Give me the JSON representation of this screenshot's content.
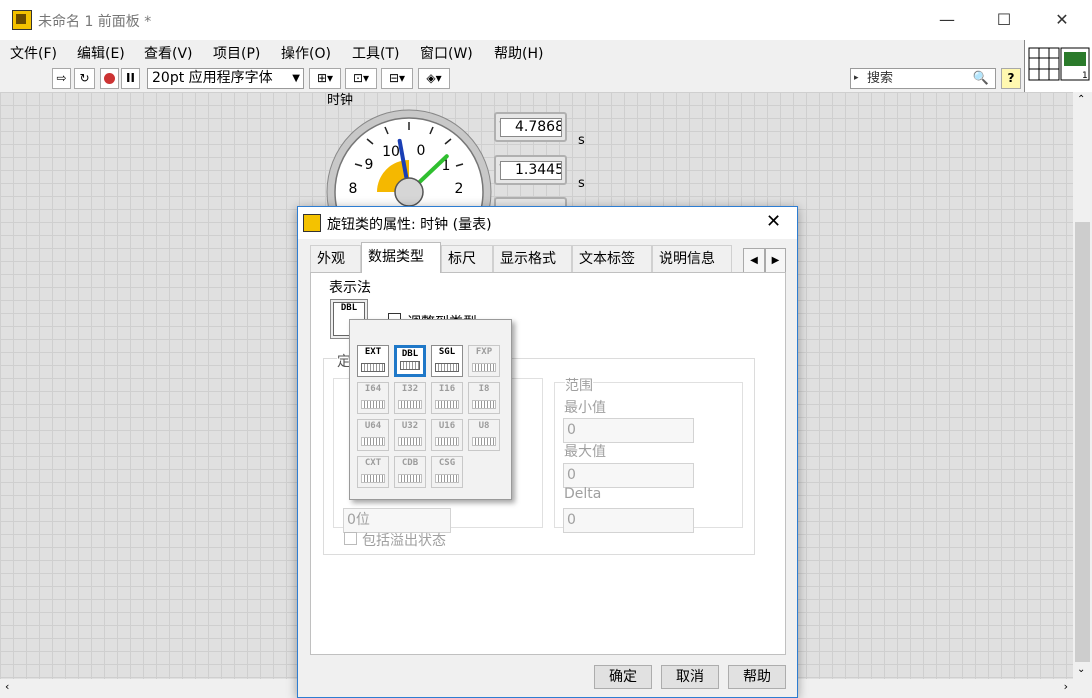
{
  "window": {
    "title": "未命名 1 前面板 *",
    "min": "—",
    "max": "☐",
    "close": "✕"
  },
  "menu": [
    "文件(F)",
    "编辑(E)",
    "查看(V)",
    "项目(P)",
    "操作(O)",
    "工具(T)",
    "窗口(W)",
    "帮助(H)"
  ],
  "toolbar": {
    "font": "20pt 应用程序字体",
    "search_placeholder": "搜索",
    "help": "?"
  },
  "front_panel": {
    "gauge": {
      "label": "时钟",
      "ticks": [
        "0",
        "1",
        "2",
        "8",
        "9",
        "10"
      ],
      "needle_a": 10.2,
      "needle_b": 1.35
    },
    "indicators": [
      {
        "value": "4.7868",
        "unit": "s"
      },
      {
        "value": "1.3445",
        "unit": "s"
      }
    ]
  },
  "dialog": {
    "title": "旋钮类的属性: 时钟 (量表)",
    "tabs": [
      "外观",
      "数据类型",
      "标尺",
      "显示格式",
      "文本标签",
      "说明信息"
    ],
    "active_tab": "数据类型",
    "representation_label": "表示法",
    "representation_current": "DBL",
    "partial_check": "调整到类型",
    "fixed_point_partial": "定",
    "range": {
      "title": "范围",
      "min_label": "最小值",
      "min_value": "0",
      "max_label": "最大值",
      "max_value": "0",
      "delta_label": "Delta",
      "delta_value": "0"
    },
    "word_length": "0位",
    "include_overflow": "包括溢出状态",
    "buttons": {
      "ok": "确定",
      "cancel": "取消",
      "help": "帮助"
    }
  },
  "representation_popup": {
    "selected": "DBL",
    "types": [
      {
        "label": "EXT",
        "enabled": true
      },
      {
        "label": "DBL",
        "enabled": true
      },
      {
        "label": "SGL",
        "enabled": true
      },
      {
        "label": "FXP",
        "enabled": false
      },
      {
        "label": "I64",
        "enabled": false
      },
      {
        "label": "I32",
        "enabled": false
      },
      {
        "label": "I16",
        "enabled": false
      },
      {
        "label": "I8",
        "enabled": false
      },
      {
        "label": "U64",
        "enabled": false
      },
      {
        "label": "U32",
        "enabled": false
      },
      {
        "label": "U16",
        "enabled": false
      },
      {
        "label": "U8",
        "enabled": false
      },
      {
        "label": "CXT",
        "enabled": false
      },
      {
        "label": "CDB",
        "enabled": false
      },
      {
        "label": "CSG",
        "enabled": false
      }
    ]
  },
  "colors": {
    "accent": "#1f78c8",
    "needle_a": "#1a3fb5",
    "needle_b": "#2fbf2f",
    "gauge_fill": "#f5b800"
  }
}
